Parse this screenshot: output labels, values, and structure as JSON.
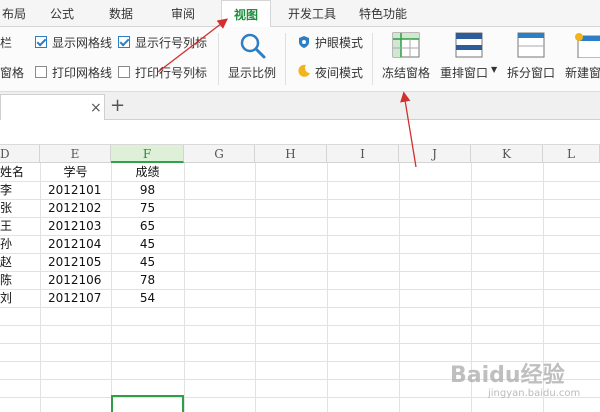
{
  "menu": {
    "tabs": [
      "布局",
      "公式",
      "数据",
      "审阅",
      "视图",
      "开发工具",
      "特色功能"
    ],
    "active": "视图"
  },
  "ribbon": {
    "left_partial": [
      "栏",
      "窗格"
    ],
    "show_gridlines": "显示网格线",
    "show_headers": "显示行号列标",
    "print_gridlines": "打印网格线",
    "print_headers": "打印行号列标",
    "zoom": "显示比例",
    "eye_mode": "护眼模式",
    "night_mode": "夜间模式",
    "freeze": "冻结窗格",
    "arrange": "重排窗口",
    "split": "拆分窗口",
    "new_window": "新建窗"
  },
  "doc": {
    "close": "×",
    "add": "+"
  },
  "columns": [
    "D",
    "E",
    "F",
    "G",
    "H",
    "I",
    "J",
    "K",
    "L"
  ],
  "table": {
    "headers": [
      "姓名",
      "学号",
      "成绩"
    ],
    "rows": [
      [
        "李",
        "2012101",
        "98"
      ],
      [
        "张",
        "2012102",
        "75"
      ],
      [
        "王",
        "2012103",
        "65"
      ],
      [
        "孙",
        "2012104",
        "45"
      ],
      [
        "赵",
        "2012105",
        "45"
      ],
      [
        "陈",
        "2012106",
        "78"
      ],
      [
        "刘",
        "2012107",
        "54"
      ]
    ]
  },
  "watermark": {
    "brand": "Baidu经验",
    "url": "jingyan.baidu.com"
  },
  "colors": {
    "accent": "#1e8e3e",
    "selection": "#2f9e44",
    "annotation_arrow": "#d32f2f"
  }
}
